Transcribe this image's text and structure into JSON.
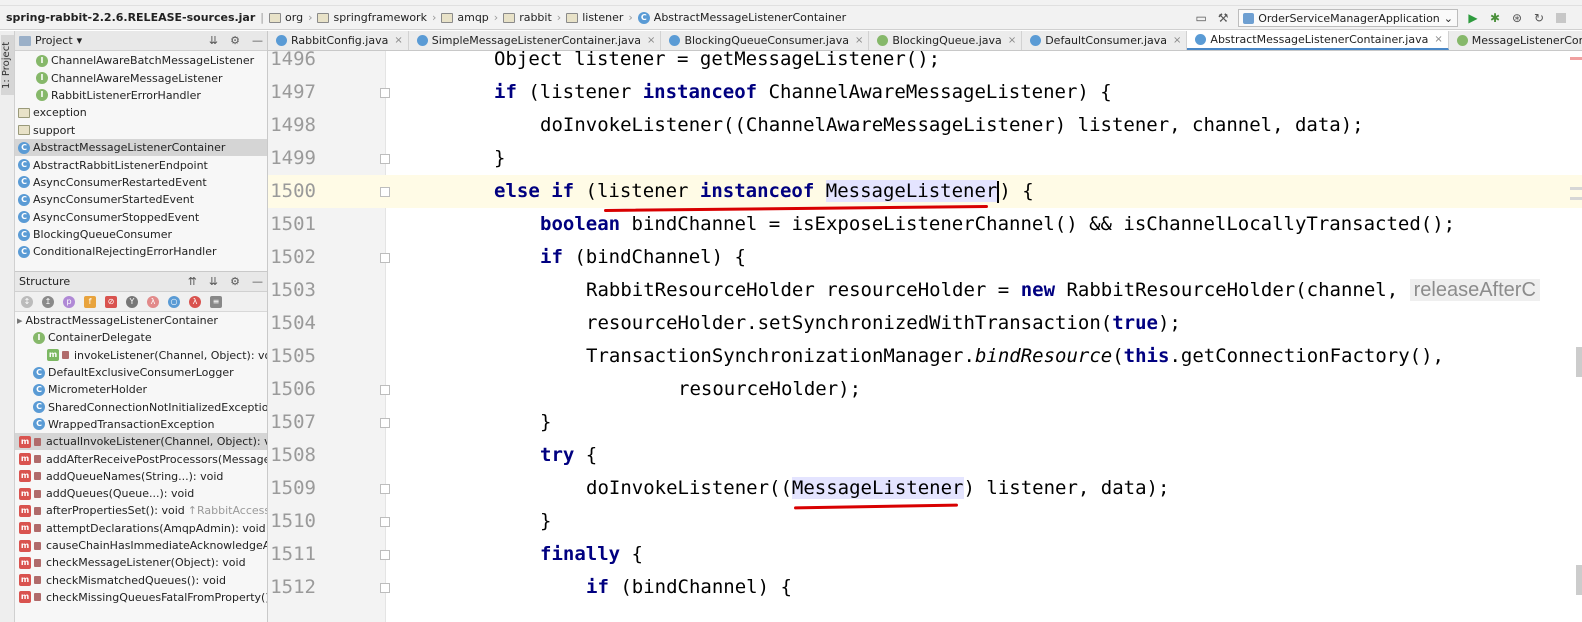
{
  "breadcrumb": {
    "jar": "spring-rabbit-2.2.6.RELEASE-sources.jar",
    "parts": [
      "org",
      "springframework",
      "amqp",
      "rabbit",
      "listener"
    ],
    "current": "AbstractMessageListenerContainer"
  },
  "run_config": {
    "label": "OrderServiceManagerApplication"
  },
  "tool_strip": {
    "project_label": "1: Project"
  },
  "project_panel": {
    "title": "Project",
    "items": [
      {
        "label": "ChannelAwareBatchMessageListener",
        "kind": "iface",
        "indent": 2
      },
      {
        "label": "ChannelAwareMessageListener",
        "kind": "iface",
        "indent": 2
      },
      {
        "label": "RabbitListenerErrorHandler",
        "kind": "iface",
        "indent": 2
      },
      {
        "label": "exception",
        "kind": "folder",
        "indent": 0
      },
      {
        "label": "support",
        "kind": "folder",
        "indent": 0
      },
      {
        "label": "AbstractMessageListenerContainer",
        "kind": "class",
        "indent": 0,
        "selected": true
      },
      {
        "label": "AbstractRabbitListenerEndpoint",
        "kind": "class",
        "indent": 0
      },
      {
        "label": "AsyncConsumerRestartedEvent",
        "kind": "class",
        "indent": 0
      },
      {
        "label": "AsyncConsumerStartedEvent",
        "kind": "class",
        "indent": 0
      },
      {
        "label": "AsyncConsumerStoppedEvent",
        "kind": "class",
        "indent": 0
      },
      {
        "label": "BlockingQueueConsumer",
        "kind": "class",
        "indent": 0
      },
      {
        "label": "ConditionalRejectingErrorHandler",
        "kind": "class",
        "indent": 0
      }
    ]
  },
  "structure_panel": {
    "title": "Structure",
    "root": "AbstractMessageListenerContainer",
    "items": [
      {
        "label": "ContainerDelegate",
        "kind": "iface-inner",
        "indent": 1
      },
      {
        "label": "invokeListener(Channel, Object): void",
        "kind": "method-green",
        "indent": 2
      },
      {
        "label": "DefaultExclusiveConsumerLogger",
        "kind": "class",
        "indent": 1
      },
      {
        "label": "MicrometerHolder",
        "kind": "class",
        "indent": 1
      },
      {
        "label": "SharedConnectionNotInitializedException",
        "kind": "class",
        "indent": 1
      },
      {
        "label": "WrappedTransactionException",
        "kind": "class",
        "indent": 1
      },
      {
        "label": "actualInvokeListener(Channel, Object): void",
        "kind": "method",
        "indent": 0,
        "selected": true
      },
      {
        "label": "addAfterReceivePostProcessors(MessagePost",
        "kind": "method",
        "indent": 0
      },
      {
        "label": "addQueueNames(String...): void",
        "kind": "method",
        "indent": 0
      },
      {
        "label": "addQueues(Queue...): void",
        "kind": "method",
        "indent": 0
      },
      {
        "label": "afterPropertiesSet(): void",
        "suffix": "↑RabbitAccessor",
        "kind": "method",
        "indent": 0
      },
      {
        "label": "attemptDeclarations(AmqpAdmin): void",
        "kind": "method",
        "indent": 0
      },
      {
        "label": "causeChainHasImmediateAcknowledgeAmqpE",
        "kind": "method",
        "indent": 0
      },
      {
        "label": "checkMessageListener(Object): void",
        "kind": "method",
        "indent": 0
      },
      {
        "label": "checkMismatchedQueues(): void",
        "kind": "method",
        "indent": 0
      },
      {
        "label": "checkMissingQueuesFatalFromProperty(): void",
        "kind": "method",
        "indent": 0
      }
    ]
  },
  "tabs": [
    {
      "label": "RabbitConfig.java",
      "icon": "class"
    },
    {
      "label": "SimpleMessageListenerContainer.java",
      "icon": "class"
    },
    {
      "label": "BlockingQueueConsumer.java",
      "icon": "class"
    },
    {
      "label": "BlockingQueue.java",
      "icon": "iface"
    },
    {
      "label": "DefaultConsumer.java",
      "icon": "class"
    },
    {
      "label": "AbstractMessageListenerContainer.java",
      "icon": "class",
      "active": true
    },
    {
      "label": "MessageListenerContainer.java",
      "icon": "iface"
    }
  ],
  "editor": {
    "lines": [
      {
        "n": "1496",
        "indent": 0,
        "tokens": [
          [
            "Object listener = getMessageListener();",
            ""
          ]
        ]
      },
      {
        "n": "1497",
        "indent": 0,
        "tokens": [
          [
            "if",
            "kw"
          ],
          [
            " (listener ",
            ""
          ],
          [
            "instanceof",
            "kw"
          ],
          [
            " ChannelAwareMessageListener) {",
            ""
          ]
        ]
      },
      {
        "n": "1498",
        "indent": 1,
        "tokens": [
          [
            "doInvokeListener((ChannelAwareMessageListener) listener, channel, data);",
            ""
          ]
        ]
      },
      {
        "n": "1499",
        "indent": 0,
        "tokens": [
          [
            "}",
            ""
          ]
        ]
      },
      {
        "n": "1500",
        "indent": 0,
        "hl": true,
        "tokens": [
          [
            "else if",
            "kw"
          ],
          [
            " (listener ",
            ""
          ],
          [
            "instanceof",
            "kw"
          ],
          [
            " ",
            ""
          ],
          [
            "MessageListener",
            "sel"
          ],
          [
            "|",
            "caret"
          ],
          [
            ") {",
            ""
          ]
        ]
      },
      {
        "n": "1501",
        "indent": 1,
        "tokens": [
          [
            "boolean",
            "kw"
          ],
          [
            " bindChannel = isExposeListenerChannel() && isChannelLocallyTransacted();",
            ""
          ]
        ]
      },
      {
        "n": "1502",
        "indent": 1,
        "tokens": [
          [
            "if",
            "kw"
          ],
          [
            " (bindChannel) {",
            ""
          ]
        ]
      },
      {
        "n": "1503",
        "indent": 2,
        "tokens": [
          [
            "RabbitResourceHolder resourceHolder = ",
            ""
          ],
          [
            "new",
            "kw"
          ],
          [
            " RabbitResourceHolder(channel, ",
            ""
          ],
          [
            "releaseAfterC",
            "hint"
          ]
        ]
      },
      {
        "n": "1504",
        "indent": 2,
        "tokens": [
          [
            "resourceHolder.setSynchronizedWithTransaction(",
            ""
          ],
          [
            "true",
            "kw"
          ],
          [
            ");",
            ""
          ]
        ]
      },
      {
        "n": "1505",
        "indent": 2,
        "tokens": [
          [
            "TransactionSynchronizationManager.",
            ""
          ],
          [
            "bindResource",
            "it"
          ],
          [
            "(",
            ""
          ],
          [
            "this",
            "kw"
          ],
          [
            ".getConnectionFactory(),",
            ""
          ]
        ]
      },
      {
        "n": "1506",
        "indent": 4,
        "tokens": [
          [
            "resourceHolder);",
            ""
          ]
        ]
      },
      {
        "n": "1507",
        "indent": 1,
        "tokens": [
          [
            "}",
            ""
          ]
        ]
      },
      {
        "n": "1508",
        "indent": 1,
        "tokens": [
          [
            "try",
            "kw"
          ],
          [
            " {",
            ""
          ]
        ]
      },
      {
        "n": "1509",
        "indent": 2,
        "tokens": [
          [
            "doInvokeListener((",
            ""
          ],
          [
            "MessageListener",
            "sel"
          ],
          [
            ") listener, data);",
            ""
          ]
        ]
      },
      {
        "n": "1510",
        "indent": 1,
        "tokens": [
          [
            "}",
            ""
          ]
        ]
      },
      {
        "n": "1511",
        "indent": 1,
        "tokens": [
          [
            "finally",
            "kw"
          ],
          [
            " {",
            ""
          ]
        ]
      },
      {
        "n": "1512",
        "indent": 2,
        "tokens": [
          [
            "if",
            "kw"
          ],
          [
            " (bindChannel) {",
            ""
          ]
        ]
      }
    ]
  },
  "colors": {
    "keyword": "#000080",
    "current_line": "#fffbe6",
    "selection": "#e4e4ff",
    "annotation_red": "#d80000"
  }
}
